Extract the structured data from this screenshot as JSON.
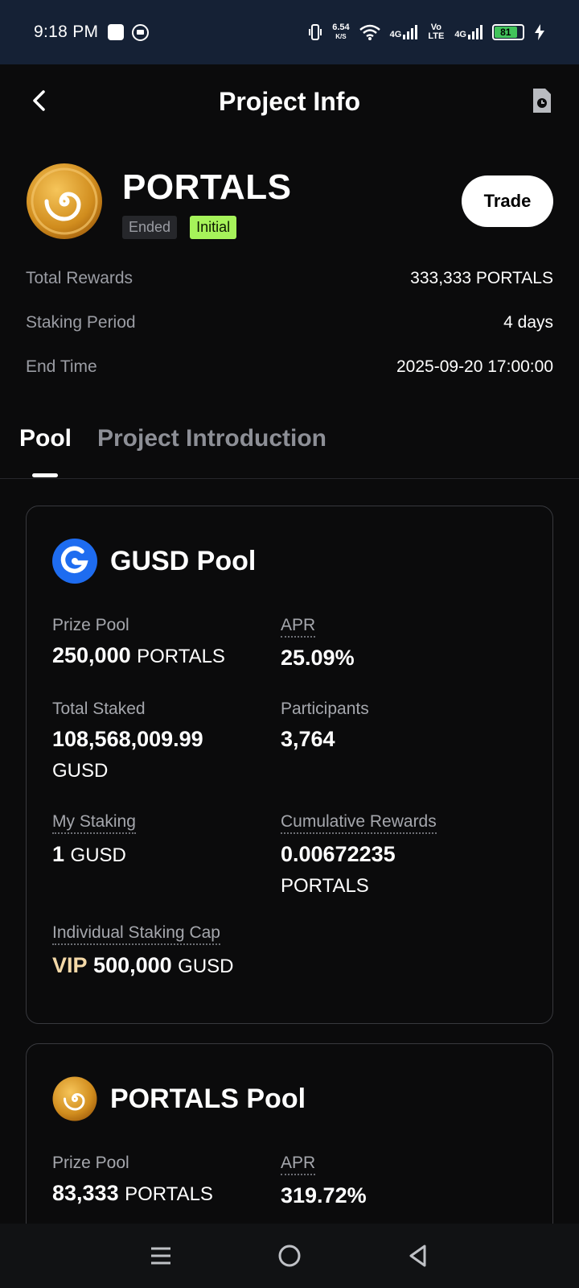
{
  "status_bar": {
    "time": "9:18 PM",
    "net_speed": "6.54",
    "net_speed_unit": "K/S",
    "signal1_label": "4G",
    "volte_label": "Vo LTE",
    "signal2_label": "4G",
    "battery": "81"
  },
  "header": {
    "title": "Project Info"
  },
  "project": {
    "name": "PORTALS",
    "status_badge": "Ended",
    "type_badge": "Initial",
    "trade_label": "Trade",
    "info": [
      {
        "label": "Total Rewards",
        "value": "333,333 PORTALS"
      },
      {
        "label": "Staking Period",
        "value": "4 days"
      },
      {
        "label": "End Time",
        "value": "2025-09-20 17:00:00"
      }
    ]
  },
  "tabs": [
    {
      "label": "Pool"
    },
    {
      "label": "Project Introduction"
    }
  ],
  "pools": [
    {
      "title": "GUSD Pool",
      "prize_pool_label": "Prize Pool",
      "prize_pool_value": "250,000",
      "prize_pool_unit": "PORTALS",
      "apr_label": "APR",
      "apr_value": "25.09%",
      "total_staked_label": "Total Staked",
      "total_staked_value": "108,568,009.99",
      "total_staked_unit": "GUSD",
      "participants_label": "Participants",
      "participants_value": "3,764",
      "my_staking_label": "My Staking",
      "my_staking_value": "1",
      "my_staking_unit": "GUSD",
      "cumulative_label": "Cumulative Rewards",
      "cumulative_value": "0.00672235",
      "cumulative_unit": "PORTALS",
      "cap_label": "Individual Staking Cap",
      "cap_vip": "VIP",
      "cap_value": "500,000",
      "cap_unit": "GUSD"
    },
    {
      "title": "PORTALS Pool",
      "prize_pool_label": "Prize Pool",
      "prize_pool_value": "83,333",
      "prize_pool_unit": "PORTALS",
      "apr_label": "APR",
      "apr_value": "319.72%"
    }
  ],
  "colors": {
    "status_bar_bg": "#152135",
    "page_bg": "#0b0b0c",
    "badge_initial": "#a6f35a",
    "vip": "#f4d9a8",
    "gusd_blue": "#1e6cf0",
    "portals_gold": "#d99a2b"
  },
  "icons": [
    "back-icon",
    "history-icon",
    "portals-logo",
    "gusd-logo",
    "menu-icon",
    "home-icon",
    "back-nav-icon"
  ]
}
